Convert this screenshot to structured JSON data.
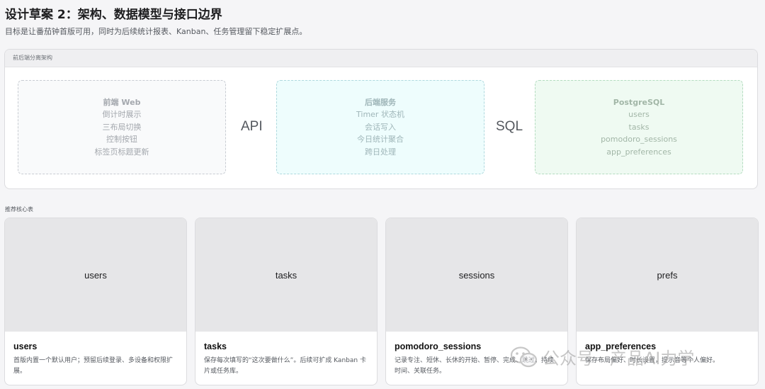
{
  "header": {
    "title": "设计草案 2：架构、数据模型与接口边界",
    "subtitle": "目标是让番茄钟首版可用，同时为后续统计报表、Kanban、任务管理留下稳定扩展点。"
  },
  "architecture": {
    "title": "前后端分离架构",
    "frontend": {
      "title": "前端 Web",
      "items": [
        "倒计时展示",
        "三布局切换",
        "控制按钮",
        "标签页标题更新"
      ]
    },
    "connector_api": "API",
    "backend": {
      "title": "后端服务",
      "items": [
        "Timer 状态机",
        "会话写入",
        "今日统计聚合",
        "跨日处理"
      ]
    },
    "connector_sql": "SQL",
    "database": {
      "title": "PostgreSQL",
      "items": [
        "users",
        "tasks",
        "pomodoro_sessions",
        "app_preferences"
      ]
    },
    "colors": {
      "frontend_bg": "#f9fafb",
      "backend_bg": "#eefdfd",
      "database_bg": "#effaf2"
    }
  },
  "tables_section": {
    "label": "推荐核心表",
    "cards": [
      {
        "thumb_label": "users",
        "title": "users",
        "desc": "首版内置一个默认用户；预留后续登录、多设备和权限扩展。"
      },
      {
        "thumb_label": "tasks",
        "title": "tasks",
        "desc": "保存每次填写的“这次要做什么”。后续可扩成 Kanban 卡片或任务库。"
      },
      {
        "thumb_label": "sessions",
        "title": "pomodoro_sessions",
        "desc": "记录专注、短休、长休的开始、暂停、完成、跳过、持续时间、关联任务。"
      },
      {
        "thumb_label": "prefs",
        "title": "app_preferences",
        "desc": "保存布局偏好、时长设置，提示音等个人偏好。"
      }
    ]
  },
  "watermark": {
    "icon": "wechat-icon",
    "text": "公众号 · 产品AI力学"
  }
}
